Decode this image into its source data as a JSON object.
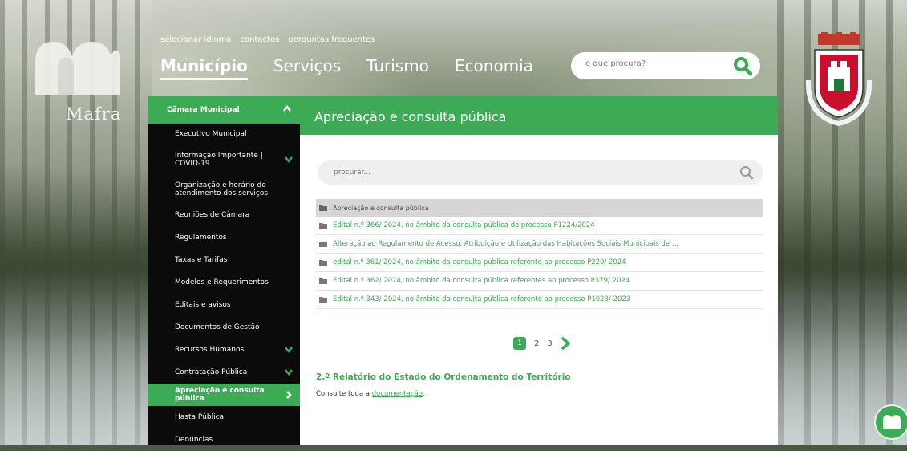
{
  "brand": {
    "logo_text": "Mafra",
    "accent": "#3daa55"
  },
  "toplinks": [
    "selecionar idioma",
    "contactos",
    "perguntas frequentes"
  ],
  "nav": [
    "Município",
    "Serviços",
    "Turismo",
    "Economia"
  ],
  "top_search": {
    "placeholder": "o que procura?"
  },
  "sidebar": {
    "header": "Câmara Municipal",
    "items": [
      {
        "label": "Executivo Municipal",
        "chevron": false
      },
      {
        "label": "Informação Importante | COVID-19",
        "chevron": true
      },
      {
        "label": "Organização e horário de atendimento dos serviços",
        "chevron": false
      },
      {
        "label": "Reuniões de Câmara",
        "chevron": false
      },
      {
        "label": "Regulamentos",
        "chevron": false
      },
      {
        "label": "Taxas e Tarifas",
        "chevron": false
      },
      {
        "label": "Modelos e Requerimentos",
        "chevron": false
      },
      {
        "label": "Editais e avisos",
        "chevron": false
      },
      {
        "label": "Documentos de Gestão",
        "chevron": false
      },
      {
        "label": "Recursos Humanos",
        "chevron": true
      },
      {
        "label": "Contratação Pública",
        "chevron": true
      },
      {
        "label": "Apreciação e consulta pública",
        "chevron": true,
        "active": true
      },
      {
        "label": "Hasta Pública",
        "chevron": false
      },
      {
        "label": "Denúncias",
        "chevron": false
      }
    ]
  },
  "content": {
    "title": "Apreciação e consulta pública",
    "search_placeholder": "procurar...",
    "folder_header": "Apreciação e consulta pública",
    "rows": [
      "Edital n.º 366/ 2024, no âmbito da consulta pública do processo P1224/2024",
      "Alteração ao Regulamento de Acesso, Atribuição e Utilização das Habitações Sociais Municipais de ...",
      "edital n.º 361/ 2024, no âmbito da consulta pública referente ao processo P220/ 2024",
      "Edital n.º 362/ 2024, no âmbito da consulta pública referentes ao processo P379/ 2024",
      "Edital n.º 343/ 2024, no âmbito da consulta pública referente ao processo P1023/ 2023"
    ],
    "pagination": {
      "current": "1",
      "pages": [
        "2",
        "3"
      ]
    },
    "report_title": "2.º Relatório do Estado do Ordenamento do Território",
    "report_text": "Consulte toda a ",
    "report_link": "documentação",
    "report_end": "."
  },
  "fab_label": "Mafra"
}
